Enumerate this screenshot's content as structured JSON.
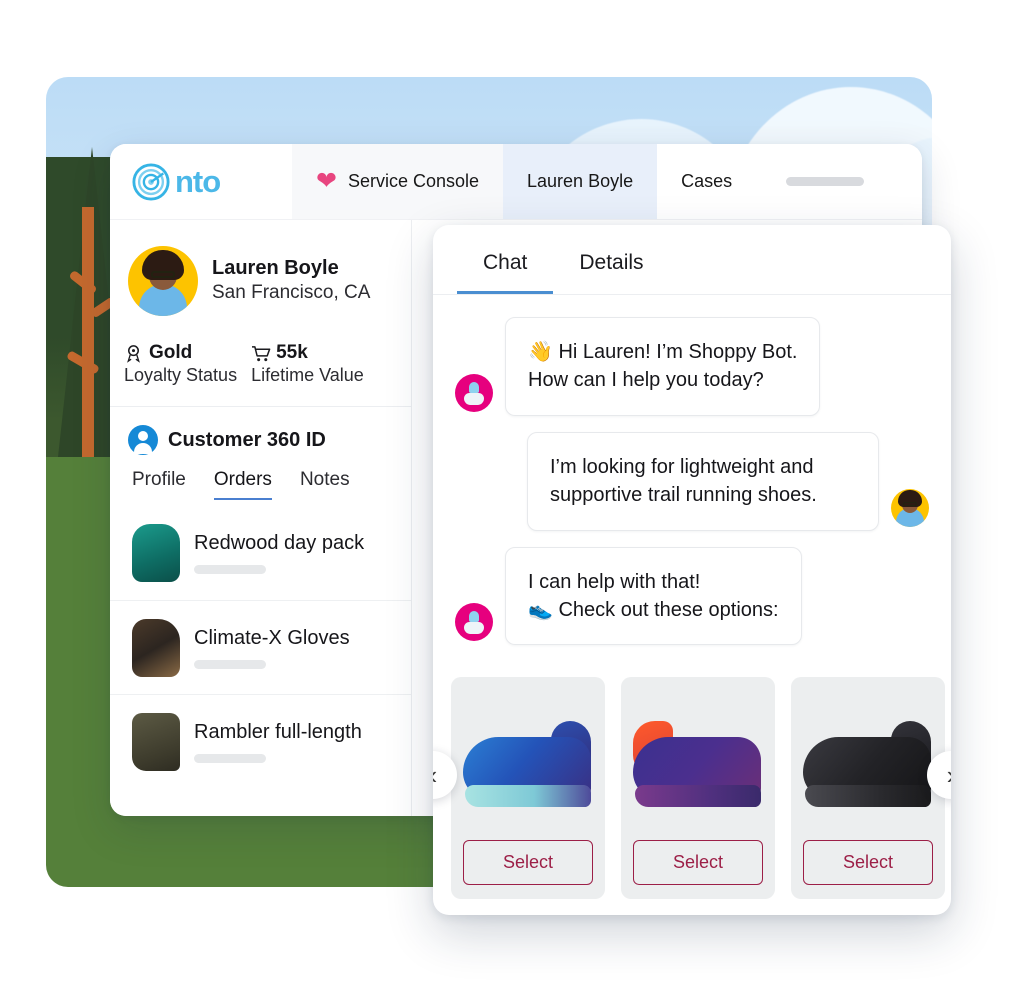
{
  "console": {
    "logo_text": "nto",
    "logo_icon": "nto-target-logo-icon",
    "app_label": "Service Console",
    "app_icon": "heart-icon",
    "tabs": [
      {
        "label": "Lauren Boyle",
        "active": true
      },
      {
        "label": "Cases",
        "active": false
      }
    ]
  },
  "profile": {
    "name": "Lauren Boyle",
    "location": "San Francisco, CA",
    "avatar_icon": "user-avatar",
    "stats": [
      {
        "icon": "award-badge-icon",
        "value": "Gold",
        "label": "Loyalty Status"
      },
      {
        "icon": "shopping-cart-icon",
        "value": "55k",
        "label": "Lifetime Value"
      }
    ],
    "customer_360": {
      "icon": "customer-360-icon",
      "title": "Customer 360 ID"
    },
    "subtabs": [
      {
        "label": "Profile",
        "active": false
      },
      {
        "label": "Orders",
        "active": true
      },
      {
        "label": "Notes",
        "active": false
      }
    ],
    "orders": [
      {
        "name": "Redwood day pack",
        "thumb": "backpack-thumb"
      },
      {
        "name": "Climate-X Gloves",
        "thumb": "gloves-thumb"
      },
      {
        "name": "Rambler full-length",
        "thumb": "boot-thumb"
      }
    ]
  },
  "chat": {
    "tabs": [
      {
        "label": "Chat",
        "active": true
      },
      {
        "label": "Details",
        "active": false
      }
    ],
    "messages": [
      {
        "sender": "bot",
        "avatar_icon": "bot-avatar-icon",
        "text": "👋 Hi Lauren! I’m Shoppy Bot.\nHow can I help you today?"
      },
      {
        "sender": "user",
        "avatar_icon": "user-avatar-icon",
        "text": "I’m looking for lightweight and supportive trail running shoes."
      },
      {
        "sender": "bot",
        "avatar_icon": "bot-avatar-icon",
        "text": "I can help with that!\n👟 Check out these options:"
      }
    ],
    "carousel": {
      "prev_icon": "chevron-left-icon",
      "next_icon": "chevron-right-icon",
      "products": [
        {
          "image": "blue-trail-running-shoe",
          "select_label": "Select"
        },
        {
          "image": "purple-orange-trail-running-shoe",
          "select_label": "Select"
        },
        {
          "image": "black-trail-running-shoe",
          "select_label": "Select"
        }
      ]
    }
  },
  "colors": {
    "brand_blue": "#4cb8e8",
    "accent_pink": "#e8457f",
    "bot_pink": "#e6007e",
    "tab_active_blue": "#4a8ed1",
    "select_crimson": "#9c1f47",
    "avatar_yellow": "#fdc300",
    "grass_green": "#55803a",
    "sky_blue": "#bcdcf6"
  }
}
